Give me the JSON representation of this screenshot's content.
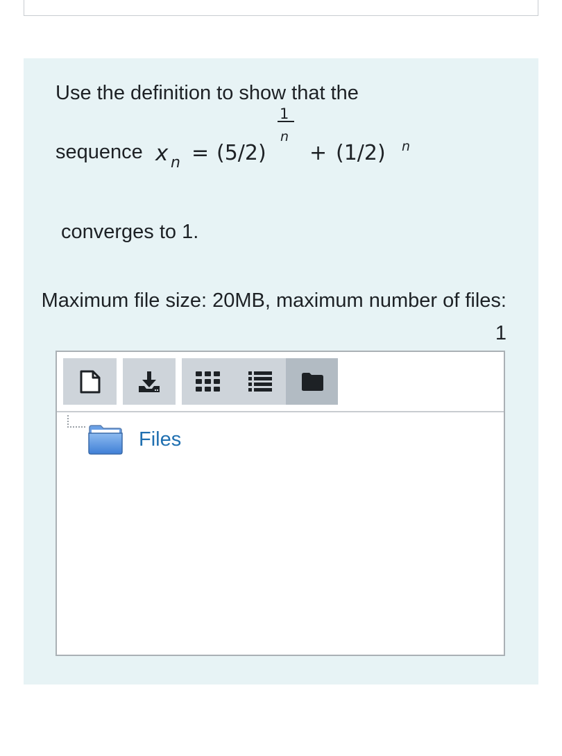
{
  "question": {
    "intro": "Use the definition to show that the",
    "sequence_word": "sequence",
    "math": {
      "var": "x",
      "sub": "n",
      "equals": "=",
      "term1": "(5/2)",
      "frac_num": "1",
      "frac_den": "n",
      "plus": "+",
      "term2": "(1/2)",
      "exp2": "n"
    },
    "conclusion": "converges to 1."
  },
  "file_limits": "Maximum file size: 20MB, maximum number of files: 1",
  "filemanager": {
    "toolbar": {
      "add_icon": "file-icon",
      "download_icon": "download-icon",
      "view_icons": [
        "grid-icon",
        "list-icon",
        "folder-icon"
      ],
      "active_view": "folder-icon"
    },
    "tree": {
      "folder_label": "Files",
      "folder_color": "#4a8fdd"
    }
  },
  "colors": {
    "panel_bg": "#e7f3f5",
    "link": "#1f6fb0",
    "button_bg": "#ced4da"
  }
}
